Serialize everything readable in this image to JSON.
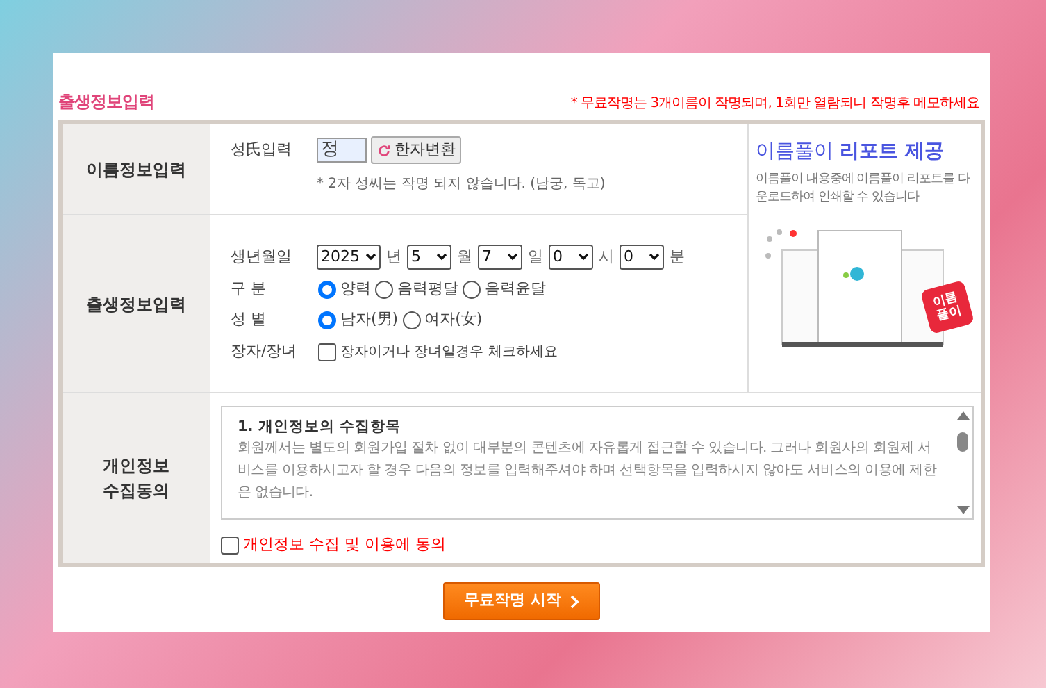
{
  "title": "출생정보입력",
  "notice": "* 무료작명는 3개이름이 작명되며, 1회만 열람되니 작명후 메모하세요",
  "name_section": {
    "header": "이름정보입력",
    "label": "성氏입력",
    "surname_value": "정",
    "hanja_button": "한자변환",
    "hint": "* 2자 성씨는 작명 되지 않습니다. (남궁, 독고)"
  },
  "promo": {
    "title_plain": "이름풀이",
    "title_bold": "리포트 제공",
    "text": "이름풀이 내용중에 이름풀이 리포트를 다운로드하여 인쇄할 수 있습니다",
    "badge": [
      "이름",
      "풀이"
    ]
  },
  "birth_section": {
    "header": "출생정보입력",
    "date_label": "생년월일",
    "selects": [
      {
        "value": "2025",
        "unit": "년"
      },
      {
        "value": "5",
        "unit": "월"
      },
      {
        "value": "7",
        "unit": "일"
      },
      {
        "value": "0",
        "unit": "시"
      },
      {
        "value": "0",
        "unit": "분"
      }
    ],
    "calendar_label": "구 분",
    "calendar_options": [
      {
        "label": "양력",
        "selected": true
      },
      {
        "label": "음력평달",
        "selected": false
      },
      {
        "label": "음력윤달",
        "selected": false
      }
    ],
    "gender_label": "성 별",
    "gender_options": [
      {
        "label": "남자(男)",
        "selected": true
      },
      {
        "label": "여자(女)",
        "selected": false
      }
    ],
    "eldest_label": "장자/장녀",
    "eldest_checkbox": {
      "label": "장자이거나 장녀일경우 체크하세요",
      "checked": false
    }
  },
  "privacy_section": {
    "header": [
      "개인정보",
      "수집동의"
    ],
    "heading": "1. 개인정보의 수집항목",
    "body": "회원께서는 별도의 회원가입 절차 없이 대부분의 콘텐츠에 자유롭게 접근할 수 있습니다. 그러나 회원사의 회원제 서비스를 이용하시고자 할 경우 다음의 정보를 입력해주셔야 하며 선택항목을 입력하시지 않아도 서비스의 이용에 제한은 없습니다.",
    "agree": {
      "label": "개인정보 수집 및 이용에 동의",
      "checked": false
    }
  },
  "submit_button": "무료작명 시작"
}
